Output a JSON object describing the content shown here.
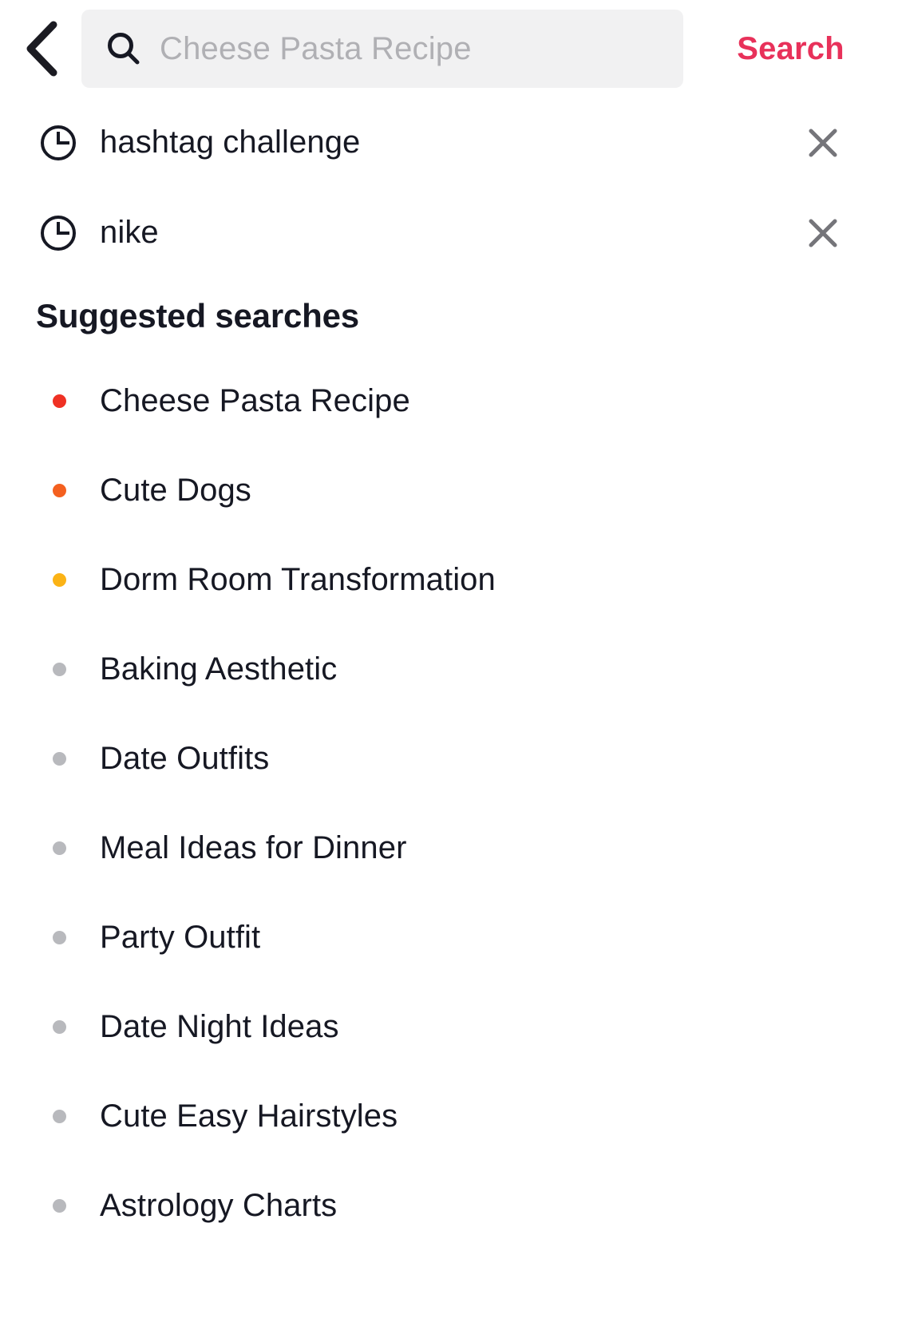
{
  "header": {
    "back_icon": "chevron-left-icon",
    "search_icon": "search-icon",
    "query_value": "",
    "query_placeholder": "Cheese Pasta Recipe",
    "search_button_label": "Search",
    "accent_color": "#e8315a",
    "field_background": "#f1f1f2"
  },
  "history": {
    "icon": "clock-icon",
    "remove_icon": "close-icon",
    "items": [
      {
        "label": "hashtag challenge"
      },
      {
        "label": "nike"
      }
    ]
  },
  "suggested": {
    "title": "Suggested searches",
    "items": [
      {
        "label": "Cheese Pasta Recipe",
        "dot_color": "#ef3124"
      },
      {
        "label": "Cute Dogs",
        "dot_color": "#f4601f"
      },
      {
        "label": "Dorm Room Transformation",
        "dot_color": "#fbb316"
      },
      {
        "label": "Baking Aesthetic",
        "dot_color": "#b8b9bd"
      },
      {
        "label": "Date Outfits",
        "dot_color": "#b8b9bd"
      },
      {
        "label": "Meal Ideas for Dinner",
        "dot_color": "#b8b9bd"
      },
      {
        "label": "Party Outfit",
        "dot_color": "#b8b9bd"
      },
      {
        "label": "Date Night Ideas",
        "dot_color": "#b8b9bd"
      },
      {
        "label": "Cute Easy Hairstyles",
        "dot_color": "#b8b9bd"
      },
      {
        "label": "Astrology Charts",
        "dot_color": "#b8b9bd"
      }
    ]
  }
}
